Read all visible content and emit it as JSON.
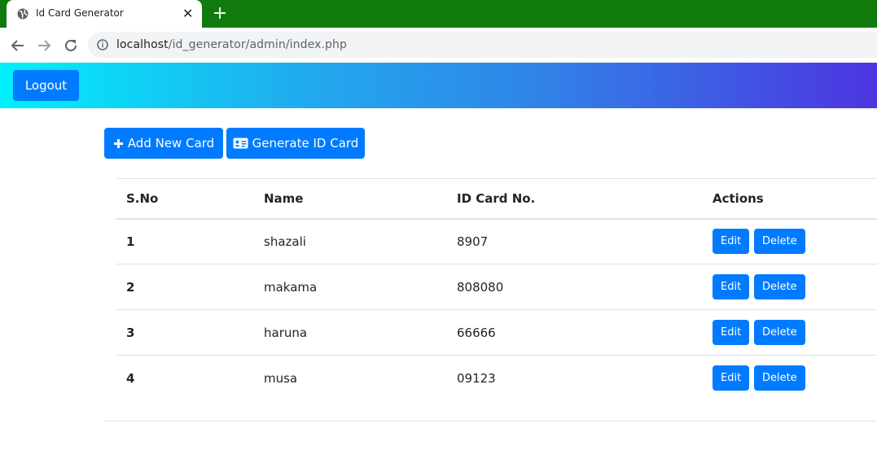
{
  "browser": {
    "tab_title": "Id Card Generator",
    "close_glyph": "✕",
    "new_tab_glyph": "+",
    "url_host": "localhost",
    "url_path": "/id_generator/admin/index.php"
  },
  "header": {
    "logout_label": "Logout",
    "gradient_colors": [
      "#00f1fb",
      "#4d35e0"
    ]
  },
  "actions": {
    "add_label": "Add New Card",
    "generate_label": "Generate ID Card"
  },
  "table": {
    "headers": [
      "S.No",
      "Name",
      "ID Card No.",
      "Actions"
    ],
    "rows": [
      {
        "sno": "1",
        "name": "shazali",
        "id": "8907"
      },
      {
        "sno": "2",
        "name": "makama",
        "id": "808080"
      },
      {
        "sno": "3",
        "name": "haruna",
        "id": "66666"
      },
      {
        "sno": "4",
        "name": "musa",
        "id": "09123"
      }
    ],
    "edit_label": "Edit",
    "delete_label": "Delete"
  },
  "colors": {
    "tabstrip": "#107a0d",
    "primary": "#007bff"
  }
}
